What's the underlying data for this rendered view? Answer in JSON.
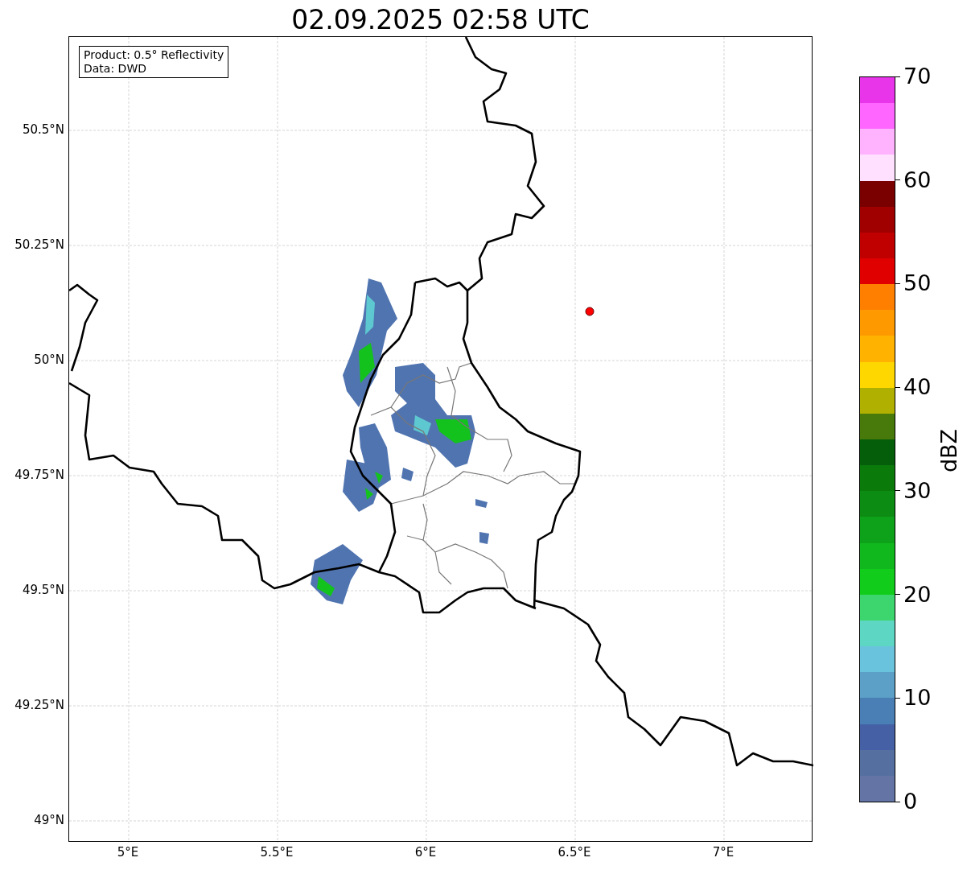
{
  "title": "02.09.2025 02:58 UTC",
  "info_box": {
    "lines": [
      "Product: 0.5° Reflectivity",
      "Data: DWD"
    ]
  },
  "y_ticks": [
    "50.5°N",
    "50.25°N",
    "50°N",
    "49.75°N",
    "49.5°N",
    "49.25°N",
    "49°N"
  ],
  "x_ticks": [
    "5°E",
    "5.5°E",
    "6°E",
    "6.5°E",
    "7°E"
  ],
  "colorbar": {
    "label": "dBZ",
    "ticks": [
      "70",
      "60",
      "50",
      "40",
      "30",
      "20",
      "10",
      "0"
    ],
    "bins": [
      {
        "color": "#e935ea"
      },
      {
        "color": "#ff66ff"
      },
      {
        "color": "#ffb3ff"
      },
      {
        "color": "#ffe0ff"
      },
      {
        "color": "#7a0000"
      },
      {
        "color": "#a00000"
      },
      {
        "color": "#c00000"
      },
      {
        "color": "#e00000"
      },
      {
        "color": "#ff7f00"
      },
      {
        "color": "#ff9900"
      },
      {
        "color": "#ffb300"
      },
      {
        "color": "#ffd700"
      },
      {
        "color": "#b0b000"
      },
      {
        "color": "#477a0a"
      },
      {
        "color": "#055e0a"
      },
      {
        "color": "#0a7a0a"
      },
      {
        "color": "#0c8c12"
      },
      {
        "color": "#0ea11a"
      },
      {
        "color": "#10b81e"
      },
      {
        "color": "#12cc1c"
      },
      {
        "color": "#3dd66e"
      },
      {
        "color": "#5ed6c4"
      },
      {
        "color": "#69c3dc"
      },
      {
        "color": "#5c9fc7"
      },
      {
        "color": "#4a7fb5"
      },
      {
        "color": "#4560a5"
      },
      {
        "color": "#5570a0"
      },
      {
        "color": "#6475a5"
      }
    ]
  }
}
